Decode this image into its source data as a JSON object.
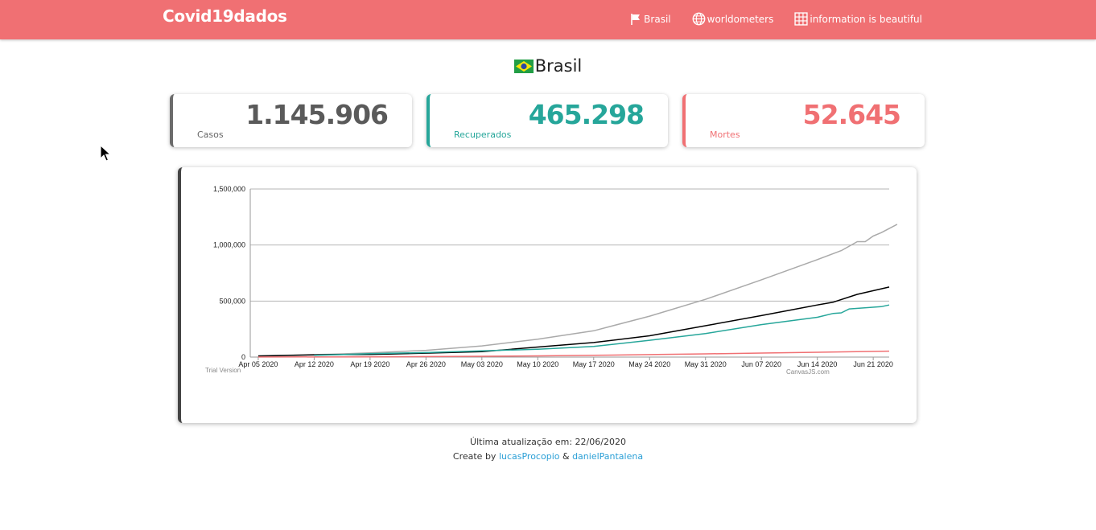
{
  "navbar": {
    "brand": "Covid19dados",
    "links": [
      {
        "label": "Brasil",
        "icon": "flag-icon"
      },
      {
        "label": "worldometers",
        "icon": "globe-icon"
      },
      {
        "label": "information is beautiful",
        "icon": "grid-icon"
      }
    ]
  },
  "country": {
    "name": "Brasil",
    "flag": "brazil-flag-icon"
  },
  "cards": {
    "casos": {
      "value": "1.145.906",
      "label": "Casos"
    },
    "recuperados": {
      "value": "465.298",
      "label": "Recuperados"
    },
    "mortes": {
      "value": "52.645",
      "label": "Mortes"
    }
  },
  "colors": {
    "brand": "#f07073",
    "recovered": "#26a69a",
    "cases": "#6b6b6b"
  },
  "chart_data": {
    "type": "line",
    "xlabels": [
      "Apr 05 2020",
      "Apr 12 2020",
      "Apr 19 2020",
      "Apr 26 2020",
      "May 03 2020",
      "May 10 2020",
      "May 17 2020",
      "May 24 2020",
      "May 31 2020",
      "Jun 07 2020",
      "Jun 14 2020",
      "Jun 21 2020"
    ],
    "xlim": [
      "2020-04-04",
      "2020-06-23"
    ],
    "ylim": [
      0,
      1500000
    ],
    "yticks": [
      "0",
      "500,000",
      "1,000,000",
      "1,500,000"
    ],
    "grid": true,
    "watermark": "Trial Version",
    "credit": "CanvasJS.com",
    "series": [
      {
        "color": "#aaaaaa",
        "points": [
          [
            "2020-04-05",
            11000
          ],
          [
            "2020-04-12",
            22000
          ],
          [
            "2020-04-14",
            25000
          ],
          [
            "2020-04-19",
            38000
          ],
          [
            "2020-04-26",
            60000
          ],
          [
            "2020-05-03",
            100000
          ],
          [
            "2020-05-10",
            160000
          ],
          [
            "2020-05-17",
            235000
          ],
          [
            "2020-05-24",
            365000
          ],
          [
            "2020-05-31",
            515000
          ],
          [
            "2020-06-07",
            690000
          ],
          [
            "2020-06-14",
            870000
          ],
          [
            "2020-06-17",
            950000
          ],
          [
            "2020-06-19",
            1030000
          ],
          [
            "2020-06-20",
            1030000
          ],
          [
            "2020-06-21",
            1080000
          ],
          [
            "2020-06-22",
            1110000
          ],
          [
            "2020-06-24",
            1185000
          ]
        ]
      },
      {
        "color": "#000000",
        "points": [
          [
            "2020-04-05",
            10000
          ],
          [
            "2020-04-12",
            20000
          ],
          [
            "2020-04-14",
            22000
          ],
          [
            "2020-04-19",
            24000
          ],
          [
            "2020-04-26",
            35000
          ],
          [
            "2020-05-03",
            48000
          ],
          [
            "2020-05-10",
            90000
          ],
          [
            "2020-05-17",
            130000
          ],
          [
            "2020-05-24",
            190000
          ],
          [
            "2020-05-31",
            280000
          ],
          [
            "2020-06-07",
            370000
          ],
          [
            "2020-06-14",
            465000
          ],
          [
            "2020-06-16",
            490000
          ],
          [
            "2020-06-19",
            560000
          ],
          [
            "2020-06-23",
            625000
          ]
        ]
      },
      {
        "color": "#26a69a",
        "points": [
          [
            "2020-04-12",
            15000
          ],
          [
            "2020-04-19",
            30000
          ],
          [
            "2020-04-26",
            40000
          ],
          [
            "2020-05-03",
            55000
          ],
          [
            "2020-05-10",
            70000
          ],
          [
            "2020-05-17",
            95000
          ],
          [
            "2020-05-24",
            150000
          ],
          [
            "2020-05-31",
            210000
          ],
          [
            "2020-06-07",
            290000
          ],
          [
            "2020-06-14",
            355000
          ],
          [
            "2020-06-16",
            390000
          ],
          [
            "2020-06-17",
            395000
          ],
          [
            "2020-06-18",
            430000
          ],
          [
            "2020-06-22",
            450000
          ],
          [
            "2020-06-23",
            465000
          ]
        ]
      },
      {
        "color": "#f07073",
        "points": [
          [
            "2020-04-05",
            500
          ],
          [
            "2020-04-19",
            2500
          ],
          [
            "2020-04-26",
            4500
          ],
          [
            "2020-05-03",
            7000
          ],
          [
            "2020-05-10",
            11000
          ],
          [
            "2020-05-17",
            16000
          ],
          [
            "2020-05-24",
            22500
          ],
          [
            "2020-05-31",
            29000
          ],
          [
            "2020-06-07",
            36000
          ],
          [
            "2020-06-14",
            43000
          ],
          [
            "2020-06-23",
            53000
          ]
        ]
      }
    ]
  },
  "footer": {
    "updated": "Última atualização em: 22/06/2020",
    "create_prefix": "Create by ",
    "author1": "lucasProcopio",
    "separator": " & ",
    "author2": "danielPantalena"
  }
}
